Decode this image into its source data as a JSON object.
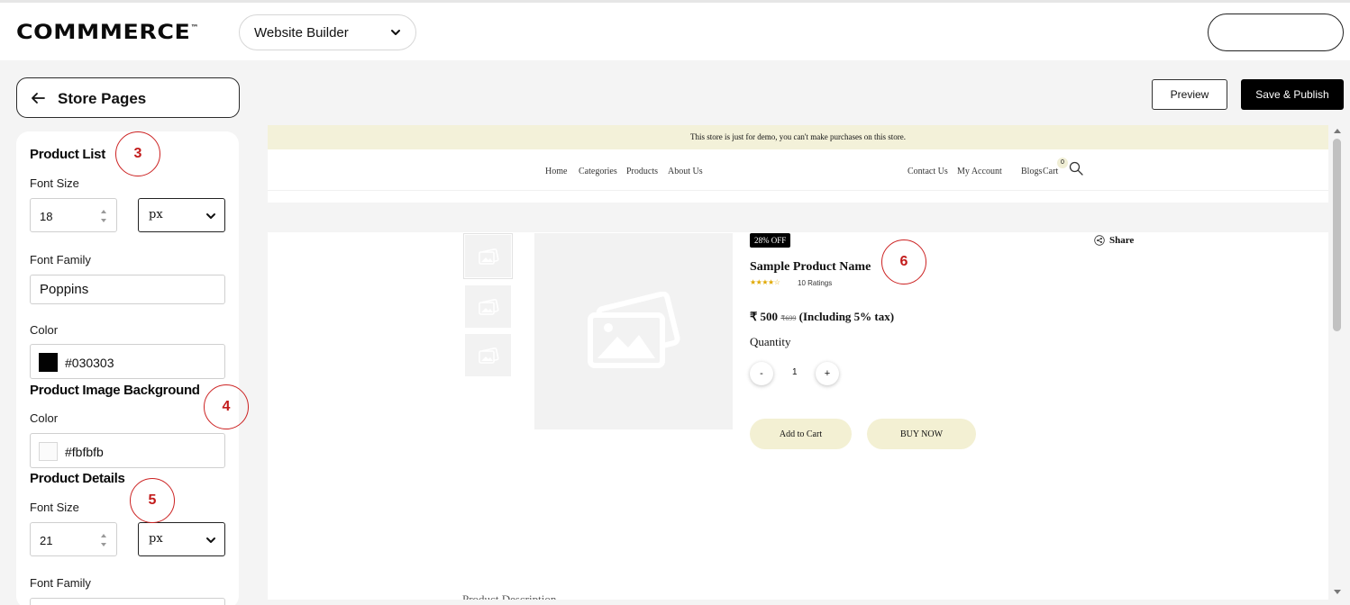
{
  "header": {
    "logo": "COMMMERCE",
    "logo_tm": "™",
    "builder_select": "Website Builder"
  },
  "sidebar": {
    "back_label": "Store Pages",
    "product_list": {
      "title": "Product List",
      "font_size_label": "Font Size",
      "font_size": "18",
      "unit": "px",
      "font_family_label": "Font Family",
      "font_family": "Poppins",
      "color_label": "Color",
      "color": "#030303"
    },
    "product_image_bg": {
      "title": "Product Image Background",
      "color_label": "Color",
      "color": "#fbfbfb"
    },
    "product_details": {
      "title": "Product Details",
      "font_size_label": "Font Size",
      "font_size": "21",
      "unit": "px",
      "font_family_label": "Font Family"
    }
  },
  "callouts": [
    "3",
    "4",
    "5",
    "6"
  ],
  "actions": {
    "preview": "Preview",
    "publish": "Save & Publish"
  },
  "store": {
    "banner": "This store is just for demo, you can't make purchases on this store.",
    "nav_left": [
      "Home",
      "Categories",
      "Products",
      "About Us"
    ],
    "nav_right": [
      "Contact Us",
      "My Account",
      "Blogs",
      "Cart"
    ],
    "cart_count": "0",
    "product": {
      "discount": "28% OFF",
      "share": "Share",
      "name": "Sample Product Name",
      "stars": "★★★★☆",
      "ratings": "10 Ratings",
      "price": "₹ 500",
      "price_old": "₹699",
      "tax_note": "(Including 5% tax)",
      "quantity_label": "Quantity",
      "qty_minus": "-",
      "qty_value": "1",
      "qty_plus": "+",
      "add_to_cart": "Add to Cart",
      "buy_now": "BUY NOW",
      "description_title": "Product Description"
    }
  },
  "colors": {
    "accent_red": "#cc2222",
    "cta_bg": "#f3f0d3",
    "banner_bg": "#f3f1d9"
  }
}
